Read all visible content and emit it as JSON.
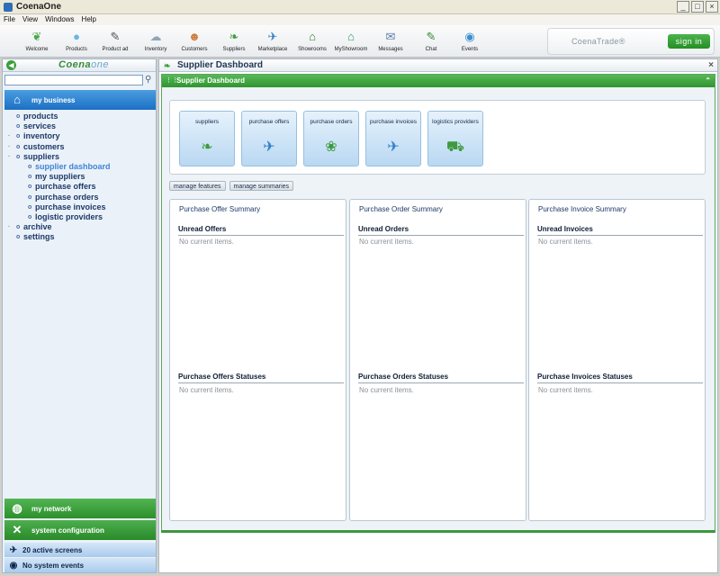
{
  "window": {
    "title": "CoenaOne",
    "min": "_",
    "max": "□",
    "close": "×"
  },
  "menu": [
    "File",
    "View",
    "Windows",
    "Help"
  ],
  "toolbar": [
    {
      "label": "Welcome",
      "icon": "welcome-icon",
      "glyph": "❦",
      "color": "#4aa84a"
    },
    {
      "label": "Products",
      "icon": "egg-icon",
      "glyph": "●",
      "color": "#6ab4e6"
    },
    {
      "label": "Product ad",
      "icon": "pen-icon",
      "glyph": "✎",
      "color": "#555555"
    },
    {
      "label": "Inventory",
      "icon": "cloud-icon",
      "glyph": "☁",
      "color": "#8fa6b8"
    },
    {
      "label": "Customers",
      "icon": "people-icon",
      "glyph": "☻",
      "color": "#d07a3a"
    },
    {
      "label": "Suppliers",
      "icon": "peapod-icon",
      "glyph": "❧",
      "color": "#3e9a3e"
    },
    {
      "label": "Marketplace",
      "icon": "bird-icon",
      "glyph": "✈",
      "color": "#2f7fc8"
    },
    {
      "label": "Showrooms",
      "icon": "house-icon",
      "glyph": "⌂",
      "color": "#2f7f2f"
    },
    {
      "label": "MyShowroom",
      "icon": "house-bird-icon",
      "glyph": "⌂",
      "color": "#2f9a5a"
    },
    {
      "label": "Messages",
      "icon": "envelope-icon",
      "glyph": "✉",
      "color": "#5a7ea8"
    },
    {
      "label": "Chat",
      "icon": "chat-bird-icon",
      "glyph": "✎",
      "color": "#3a8a3a"
    },
    {
      "label": "Events",
      "icon": "events-icon",
      "glyph": "◉",
      "color": "#3a8fd0"
    }
  ],
  "brand": {
    "name": "CoenaTrade®",
    "signin": "sign in"
  },
  "left": {
    "logo_main": "Coena",
    "logo_sub": "one",
    "search_placeholder": "",
    "mybusiness": "my business",
    "tree": [
      {
        "label": "products",
        "level": 0,
        "twisty": "",
        "active": false
      },
      {
        "label": "services",
        "level": 0,
        "twisty": "",
        "active": false
      },
      {
        "label": "inventory",
        "level": 0,
        "twisty": "·",
        "active": false
      },
      {
        "label": "customers",
        "level": 0,
        "twisty": "·",
        "active": false
      },
      {
        "label": "suppliers",
        "level": 0,
        "twisty": "·",
        "active": false
      },
      {
        "label": "supplier dashboard",
        "level": 1,
        "twisty": "",
        "active": true
      },
      {
        "label": "my suppliers",
        "level": 1,
        "twisty": "",
        "active": false
      },
      {
        "label": "purchase offers",
        "level": 1,
        "twisty": "",
        "active": false
      },
      {
        "label": "purchase orders",
        "level": 1,
        "twisty": "",
        "active": false
      },
      {
        "label": "purchase invoices",
        "level": 1,
        "twisty": "",
        "active": false
      },
      {
        "label": "logistic providers",
        "level": 1,
        "twisty": "",
        "active": false
      },
      {
        "label": "archive",
        "level": 0,
        "twisty": "·",
        "active": false
      },
      {
        "label": "settings",
        "level": 0,
        "twisty": "",
        "active": false
      }
    ],
    "network": "my network",
    "sysconf": "system configuration",
    "active_screens": "20 active screens",
    "system_events": "No system events"
  },
  "main": {
    "tab_title": "Supplier Dashboard",
    "panel_title": "Supplier Dashboard",
    "features": [
      {
        "label": "suppliers",
        "icon": "peapod-icon",
        "glyph": "❧",
        "color": "#3e9a3e"
      },
      {
        "label": "purchase offers",
        "icon": "bird-icon",
        "glyph": "✈",
        "color": "#2f7fc8"
      },
      {
        "label": "purchase orders",
        "icon": "nest-icon",
        "glyph": "❀",
        "color": "#3e9a3e"
      },
      {
        "label": "purchase invoices",
        "icon": "flying-bird-icon",
        "glyph": "✈",
        "color": "#2f7fc8"
      },
      {
        "label": "logistics providers",
        "icon": "wagon-icon",
        "glyph": "⛟",
        "color": "#3e9a3e"
      }
    ],
    "buttons": {
      "manage_features": "manage features",
      "manage_summaries": "manage summaries"
    },
    "columns": [
      {
        "title": "Purchase Offer Summary",
        "sec1": "Unread Offers",
        "sec2": "Purchase Offers Statuses",
        "empty": "No current items."
      },
      {
        "title": "Purchase Order Summary",
        "sec1": "Unread Orders",
        "sec2": "Purchase Orders Statuses",
        "empty": "No current items."
      },
      {
        "title": "Purchase Invoice Summary",
        "sec1": "Unread Invoices",
        "sec2": "Purchase Invoices Statuses",
        "empty": "No current items."
      }
    ]
  }
}
